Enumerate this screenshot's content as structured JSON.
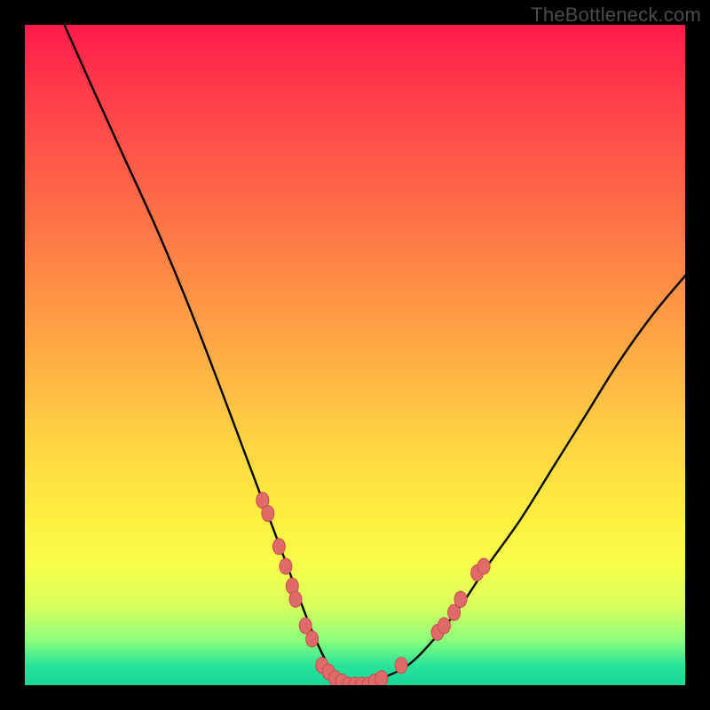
{
  "credit": "TheBottleneck.com",
  "colors": {
    "page_bg": "#000000",
    "gradient_top": "#ff1a4b",
    "gradient_bottom": "#16d89a",
    "curve_stroke": "#000000",
    "marker_fill": "#e06a6a",
    "marker_stroke": "#c44e4e"
  },
  "chart_data": {
    "type": "line",
    "title": "",
    "xlabel": "",
    "ylabel": "",
    "xlim": [
      0,
      100
    ],
    "ylim": [
      0,
      100
    ],
    "grid": false,
    "legend": false,
    "series": [
      {
        "name": "bottleneck-curve",
        "x": [
          6,
          10,
          15,
          20,
          25,
          30,
          33,
          36,
          39,
          42,
          44,
          46,
          48,
          50,
          52,
          54,
          58,
          62,
          66,
          70,
          75,
          80,
          85,
          90,
          95,
          100
        ],
        "values": [
          100,
          91,
          80,
          69,
          57,
          44,
          36,
          28,
          20,
          12,
          7,
          3,
          1,
          0,
          0,
          1,
          3,
          7,
          12,
          18,
          25,
          33,
          41,
          49,
          56,
          62
        ]
      }
    ],
    "markers": [
      {
        "x": 36.0,
        "y": 28
      },
      {
        "x": 36.8,
        "y": 26
      },
      {
        "x": 38.5,
        "y": 21
      },
      {
        "x": 39.5,
        "y": 18
      },
      {
        "x": 40.5,
        "y": 15
      },
      {
        "x": 41.0,
        "y": 13
      },
      {
        "x": 42.5,
        "y": 9
      },
      {
        "x": 43.5,
        "y": 7
      },
      {
        "x": 45.0,
        "y": 3
      },
      {
        "x": 46.0,
        "y": 2
      },
      {
        "x": 47.0,
        "y": 1
      },
      {
        "x": 48.0,
        "y": 0.5
      },
      {
        "x": 49.0,
        "y": 0
      },
      {
        "x": 50.0,
        "y": 0
      },
      {
        "x": 51.0,
        "y": 0
      },
      {
        "x": 52.0,
        "y": 0
      },
      {
        "x": 53.0,
        "y": 0.5
      },
      {
        "x": 54.0,
        "y": 1
      },
      {
        "x": 57.0,
        "y": 3
      },
      {
        "x": 62.5,
        "y": 8
      },
      {
        "x": 63.5,
        "y": 9
      },
      {
        "x": 65.0,
        "y": 11
      },
      {
        "x": 66.0,
        "y": 13
      },
      {
        "x": 68.5,
        "y": 17
      },
      {
        "x": 69.5,
        "y": 18
      }
    ]
  }
}
